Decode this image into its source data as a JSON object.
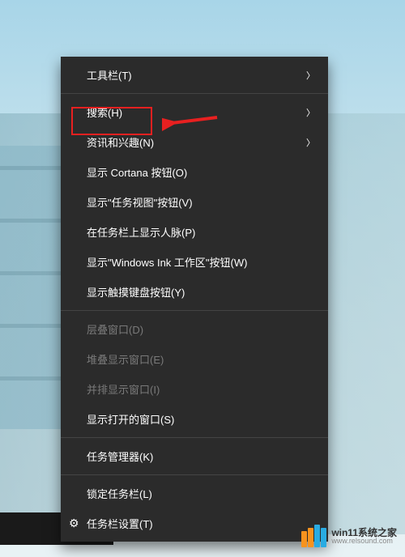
{
  "menu": {
    "items": [
      {
        "label": "工具栏(T)",
        "submenu": true,
        "enabled": true
      },
      {
        "divider": true
      },
      {
        "label": "搜索(H)",
        "submenu": true,
        "enabled": true,
        "highlighted": true
      },
      {
        "label": "资讯和兴趣(N)",
        "submenu": true,
        "enabled": true
      },
      {
        "label": "显示 Cortana 按钮(O)",
        "submenu": false,
        "enabled": true
      },
      {
        "label": "显示\"任务视图\"按钮(V)",
        "submenu": false,
        "enabled": true
      },
      {
        "label": "在任务栏上显示人脉(P)",
        "submenu": false,
        "enabled": true
      },
      {
        "label": "显示\"Windows Ink 工作区\"按钮(W)",
        "submenu": false,
        "enabled": true
      },
      {
        "label": "显示触摸键盘按钮(Y)",
        "submenu": false,
        "enabled": true
      },
      {
        "divider": true
      },
      {
        "label": "层叠窗口(D)",
        "submenu": false,
        "enabled": false
      },
      {
        "label": "堆叠显示窗口(E)",
        "submenu": false,
        "enabled": false
      },
      {
        "label": "并排显示窗口(I)",
        "submenu": false,
        "enabled": false
      },
      {
        "label": "显示打开的窗口(S)",
        "submenu": false,
        "enabled": true
      },
      {
        "divider": true
      },
      {
        "label": "任务管理器(K)",
        "submenu": false,
        "enabled": true
      },
      {
        "divider": true
      },
      {
        "label": "锁定任务栏(L)",
        "submenu": false,
        "enabled": true
      },
      {
        "label": "任务栏设置(T)",
        "submenu": false,
        "enabled": true,
        "icon": "gear"
      }
    ]
  },
  "watermark": {
    "main": "win11系统之家",
    "sub": "www.relsound.com",
    "bars": [
      {
        "color": "#f7931e",
        "height": 20
      },
      {
        "color": "#f7931e",
        "height": 24
      },
      {
        "color": "#29abe2",
        "height": 28
      },
      {
        "color": "#29abe2",
        "height": 24
      }
    ]
  },
  "annotation": {
    "arrow_color": "#e82020"
  }
}
